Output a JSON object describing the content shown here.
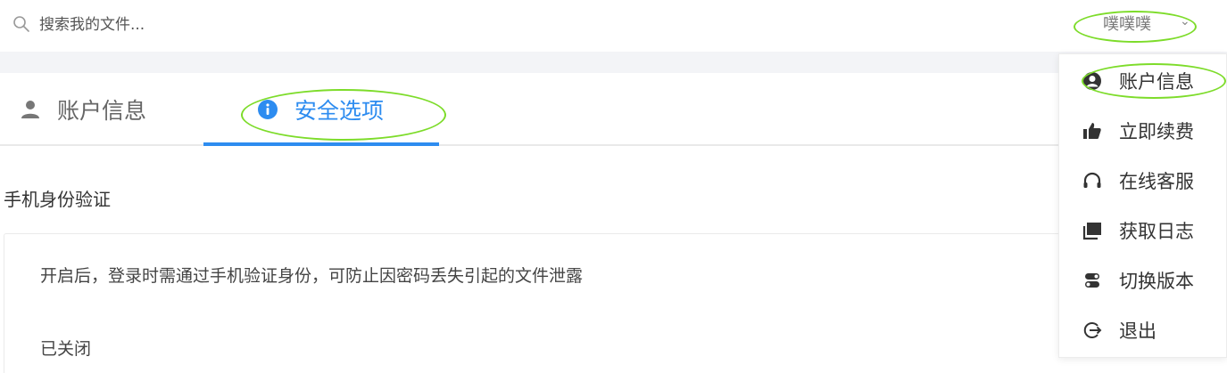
{
  "header": {
    "search": {
      "placeholder": "搜索我的文件..."
    },
    "user": {
      "name": "噗噗噗",
      "caret": "⌄"
    }
  },
  "tabs": [
    {
      "label": "账户信息",
      "icon": "user-icon",
      "active": false
    },
    {
      "label": "安全选项",
      "icon": "info-icon",
      "active": true
    }
  ],
  "section": {
    "title": "手机身份验证",
    "description": "开启后，登录时需通过手机验证身份，可防止因密码丢失引起的文件泄露",
    "status": "已关闭"
  },
  "menu": {
    "items": [
      {
        "label": "账户信息",
        "icon": "user-circle-icon"
      },
      {
        "label": "立即续费",
        "icon": "thumbs-up-icon"
      },
      {
        "label": "在线客服",
        "icon": "headset-icon"
      },
      {
        "label": "获取日志",
        "icon": "log-icon"
      },
      {
        "label": "切换版本",
        "icon": "toggle-icon"
      },
      {
        "label": "退出",
        "icon": "logout-icon"
      }
    ]
  },
  "colors": {
    "accent": "#2d8cf0",
    "annotation": "#7ddc2a",
    "band": "#f3f4f7"
  }
}
